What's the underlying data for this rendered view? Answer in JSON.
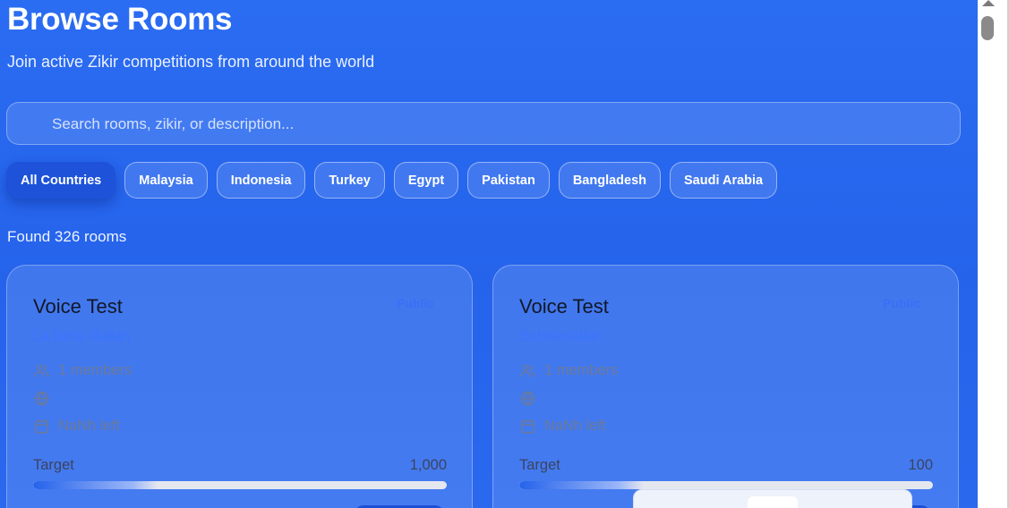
{
  "header": {
    "title": "Browse Rooms",
    "subtitle": "Join active Zikir competitions from around the world"
  },
  "search": {
    "placeholder": "Search rooms, zikir, or description...",
    "value": ""
  },
  "filters": [
    {
      "label": "All Countries",
      "active": true
    },
    {
      "label": "Malaysia",
      "active": false
    },
    {
      "label": "Indonesia",
      "active": false
    },
    {
      "label": "Turkey",
      "active": false
    },
    {
      "label": "Egypt",
      "active": false
    },
    {
      "label": "Pakistan",
      "active": false
    },
    {
      "label": "Bangladesh",
      "active": false
    },
    {
      "label": "Saudi Arabia",
      "active": false
    }
  ],
  "results": {
    "found_label": "Found 326 rooms"
  },
  "rooms": [
    {
      "title": "Voice Test",
      "visibility": "Public",
      "zikir": "La ilaha illallah",
      "members": "1 members",
      "country": "",
      "time_left": "NaNh left",
      "target_label": "Target",
      "target_value": "1,000",
      "progress": 0.3
    },
    {
      "title": "Voice Test",
      "visibility": "Public",
      "zikir": "SubhanAllah",
      "members": "1 members",
      "country": "",
      "time_left": "NaNh left",
      "target_label": "Target",
      "target_value": "100",
      "progress": 0.3
    }
  ],
  "colors": {
    "background": "#2563eb",
    "active_chip": "#1d52d9",
    "zikir_text": "#3b74ff",
    "title_text": "#111827"
  },
  "icons": [
    "search-icon",
    "users-icon",
    "globe-icon",
    "calendar-icon"
  ]
}
